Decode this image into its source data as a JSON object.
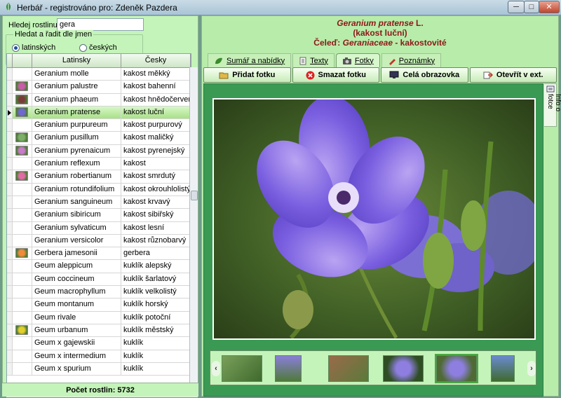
{
  "window": {
    "title": "Herbář - registrováno pro: Zdeněk Pazdera",
    "min": "─",
    "max": "□",
    "close": "✕"
  },
  "left": {
    "search_label": "Hledej rostlinu:",
    "search_value": "gera",
    "sort_group_label": "Hledat a řadit dle jmen",
    "radio_latin": "latinských",
    "radio_czech": "českých",
    "columns": {
      "latin": "Latinsky",
      "czech": "Česky"
    },
    "rows": [
      {
        "latin": "Geranium molle",
        "czech": "kakost měkký",
        "thumb": ""
      },
      {
        "latin": "Geranium palustre",
        "czech": "kakost bahenní",
        "thumb": "#c95da8"
      },
      {
        "latin": "Geranium phaeum",
        "czech": "kakost hnědočervený",
        "thumb": "#7a3a3a"
      },
      {
        "latin": "Geranium pratense",
        "czech": "kakost luční",
        "thumb": "#7068d0",
        "selected": true
      },
      {
        "latin": "Geranium purpureum",
        "czech": "kakost purpurový",
        "thumb": ""
      },
      {
        "latin": "Geranium pusillum",
        "czech": "kakost maličký",
        "thumb": "#7fae6a"
      },
      {
        "latin": "Geranium pyrenaicum",
        "czech": "kakost pyrenejský",
        "thumb": "#c97ac8"
      },
      {
        "latin": "Geranium reflexum",
        "czech": "kakost",
        "thumb": ""
      },
      {
        "latin": "Geranium robertianum",
        "czech": "kakost smrdutý",
        "thumb": "#e26aa5"
      },
      {
        "latin": "Geranium rotundifolium",
        "czech": "kakost okrouhlolistý",
        "thumb": ""
      },
      {
        "latin": "Geranium sanguineum",
        "czech": "kakost krvavý",
        "thumb": ""
      },
      {
        "latin": "Geranium sibiricum",
        "czech": "kakost sibiřský",
        "thumb": ""
      },
      {
        "latin": "Geranium sylvaticum",
        "czech": "kakost lesní",
        "thumb": ""
      },
      {
        "latin": "Geranium versicolor",
        "czech": "kakost různobarvý",
        "thumb": ""
      },
      {
        "latin": "Gerbera jamesonii",
        "czech": "gerbera",
        "thumb": "#f08a3a"
      },
      {
        "latin": "Geum aleppicum",
        "czech": "kuklík alepský",
        "thumb": ""
      },
      {
        "latin": "Geum coccineum",
        "czech": "kuklík šarlatový",
        "thumb": ""
      },
      {
        "latin": "Geum macrophyllum",
        "czech": "kuklík velkolistý",
        "thumb": ""
      },
      {
        "latin": "Geum montanum",
        "czech": "kuklík horský",
        "thumb": ""
      },
      {
        "latin": "Geum rivale",
        "czech": "kuklík potoční",
        "thumb": ""
      },
      {
        "latin": "Geum urbanum",
        "czech": "kuklík městský",
        "thumb": "#e3cf2c"
      },
      {
        "latin": "Geum x gajewskii",
        "czech": "kuklík",
        "thumb": ""
      },
      {
        "latin": "Geum x intermedium",
        "czech": "kuklík",
        "thumb": ""
      },
      {
        "latin": "Geum x spurium",
        "czech": "kuklík",
        "thumb": ""
      }
    ],
    "count_label": "Počet rostlin: 5732"
  },
  "right": {
    "latin_name": "Geranium pratense",
    "author": "L.",
    "czech_name": "(kakost luční)",
    "family_prefix": "Čeleď:",
    "family_latin": "Geraniaceae",
    "family_czech": "- kakostovité",
    "tabs": [
      {
        "label": "Sumář a nabídky",
        "icon": "leaf-icon",
        "active": false
      },
      {
        "label": "Texty",
        "icon": "document-icon",
        "active": false
      },
      {
        "label": "Fotky",
        "icon": "camera-icon",
        "active": true
      },
      {
        "label": "Poznámky",
        "icon": "pencil-icon",
        "active": false
      }
    ],
    "toolbar": {
      "add": "Přidat fotku",
      "delete": "Smazat fotku",
      "fullscreen": "Celá obrazovka",
      "open_ext": "Otevřít v ext."
    },
    "side_tab": "Info o fotce",
    "strip_left": "‹",
    "strip_right": "›"
  },
  "colors": {
    "accent": "#8b1818",
    "panel": "#c4f4b9",
    "photo_bg": "#3a9a54"
  }
}
